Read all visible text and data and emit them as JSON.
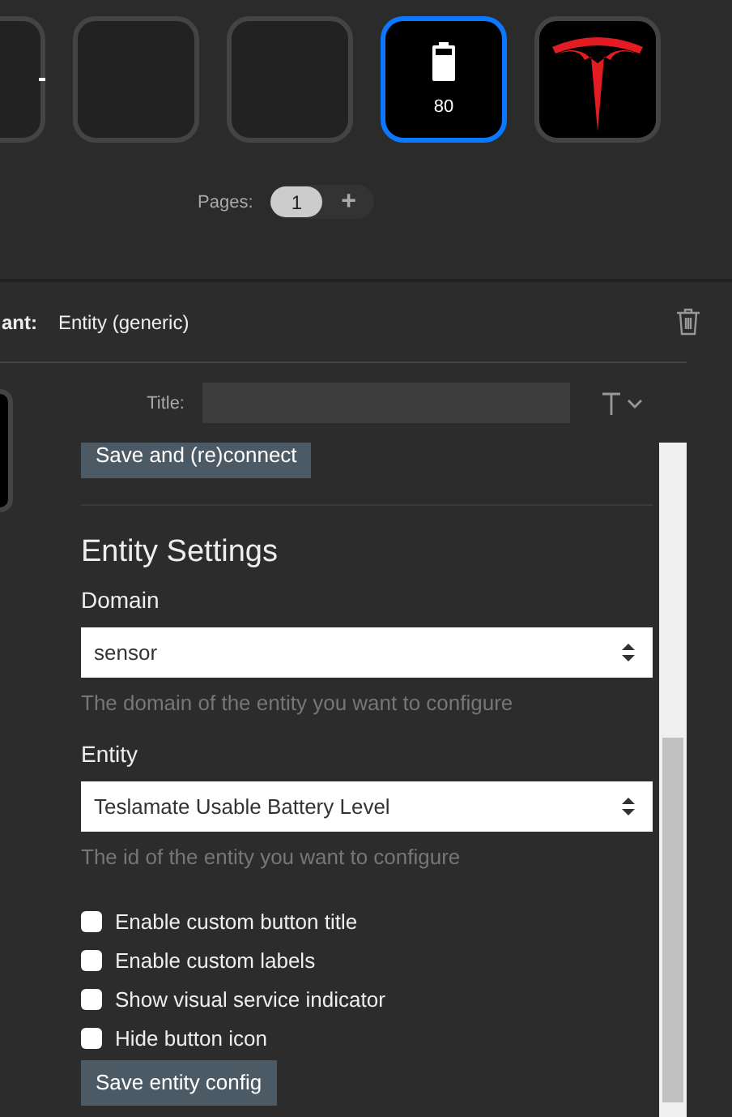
{
  "keys": [
    {
      "kind": "partial",
      "selected": false
    },
    {
      "kind": "empty",
      "selected": false
    },
    {
      "kind": "empty",
      "selected": false
    },
    {
      "kind": "battery",
      "label": "80",
      "selected": true
    },
    {
      "kind": "logo",
      "selected": false
    }
  ],
  "pages": {
    "label": "Pages:",
    "items": [
      {
        "label": "1",
        "selected": true
      }
    ],
    "add": "+"
  },
  "action": {
    "label": "ant:",
    "value": "Entity (generic)"
  },
  "title_field": {
    "label": "Title:"
  },
  "connect_button": "Save and (re)connect",
  "entity_settings": {
    "heading": "Entity Settings",
    "fields": [
      {
        "label": "Domain",
        "value": "sensor",
        "help": "The domain of the entity you want to configure"
      },
      {
        "label": "Entity",
        "value": "Teslamate Usable Battery Level",
        "help": "The id of the entity you want to configure"
      }
    ],
    "options": [
      {
        "label": "Enable custom button title",
        "checked": false
      },
      {
        "label": "Enable custom labels",
        "checked": false
      },
      {
        "label": "Show visual service indicator",
        "checked": false
      },
      {
        "label": "Hide button icon",
        "checked": false
      }
    ],
    "save_button": "Save entity config"
  }
}
